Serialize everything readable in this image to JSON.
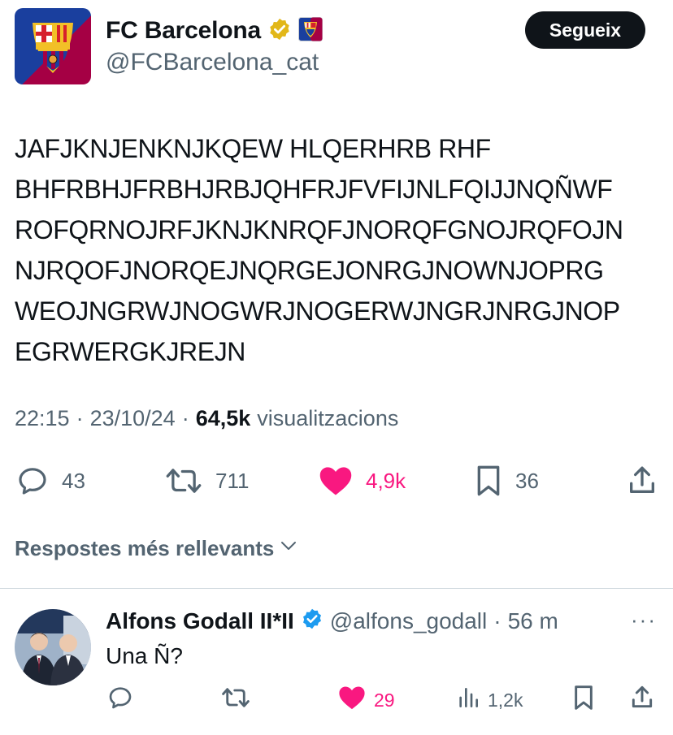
{
  "tweet": {
    "author": {
      "display_name": "FC Barcelona",
      "handle": "@FCBarcelona_cat",
      "avatar": "fcb-crest",
      "verified_badge": "gold-verified-badge",
      "affiliate_badge": "fcb-mini-crest"
    },
    "follow_label": "Segueix",
    "text_lines": [
      "JAFJKNJENKNJKQEW HLQERHRB RHF",
      "BHFRBHJFRBHJRBJQHFRJFVFIJNLFQIJJNQÑWF",
      "ROFQRNOJRFJKNJKNRQFJNORQFGNOJRQFOJN",
      "NJRQOFJNORQEJNQRGEJONRGJNOWNJOPRG",
      "WEOJNGRWJNOGWRJNOGERWJNGRJNRGJNOP",
      "EGRWERGKJREJN"
    ],
    "time": "22:15",
    "separator": "·",
    "date": "23/10/24",
    "views_count": "64,5k",
    "views_label": "visualitzacions",
    "actions": {
      "replies": "43",
      "reposts": "711",
      "likes": "4,9k",
      "bookmarks": "36"
    }
  },
  "replies_header": "Respostes més rellevants",
  "reply": {
    "display_name": "Alfons Godall II*II",
    "handle": "@alfons_godall",
    "separator": "·",
    "time": "56 m",
    "text": "Una Ñ?",
    "more": "···",
    "actions": {
      "likes": "29",
      "views": "1,2k"
    }
  },
  "colors": {
    "like_pink": "#f91880",
    "secondary_text": "#536471",
    "verified_blue": "#1d9bf0",
    "verified_gold": "#e2b719",
    "barca_blue": "#0a4595",
    "barca_red": "#a50044"
  }
}
